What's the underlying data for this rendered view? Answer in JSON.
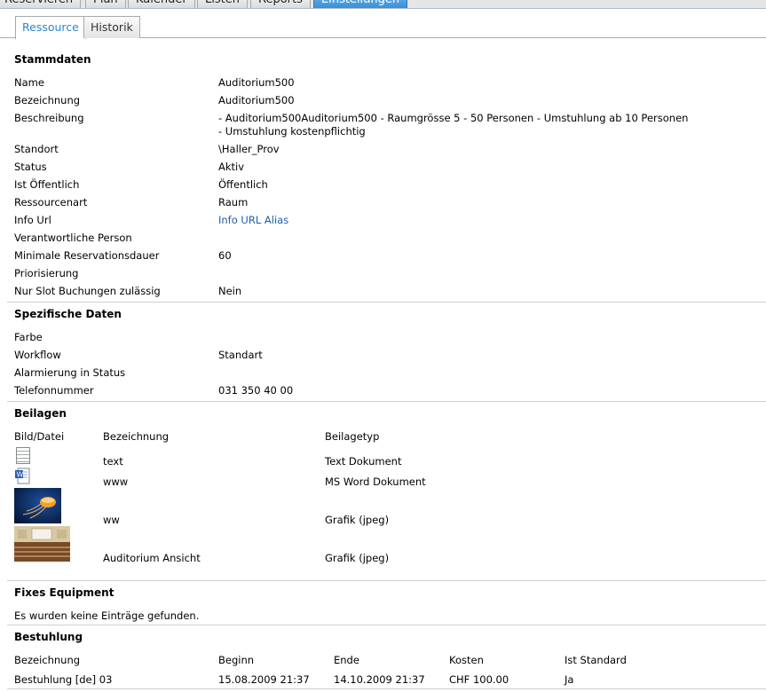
{
  "topnav": {
    "tabs": [
      "Reservieren",
      "Plan",
      "Kalender",
      "Listen",
      "Reports",
      "Einstellungen"
    ],
    "active": "Einstellungen"
  },
  "subtabs": [
    "Ressource",
    "Historik"
  ],
  "stammdaten": {
    "title": "Stammdaten",
    "rows": [
      {
        "label": "Name",
        "value": "Auditorium500"
      },
      {
        "label": "Bezeichnung",
        "value": "Auditorium500"
      },
      {
        "label": "Beschreibung",
        "value": "- Auditorium500Auditorium500 - Raumgrösse 5 - 50 Personen - Umstuhlung ab 10 Personen",
        "value2": "- Umstuhlung kostenpflichtig"
      },
      {
        "label": "Standort",
        "value": "\\Haller_Prov"
      },
      {
        "label": "Status",
        "value": "Aktiv"
      },
      {
        "label": "Ist Öffentlich",
        "value": "Öffentlich"
      },
      {
        "label": "Ressourcenart",
        "value": "Raum"
      },
      {
        "label": "Info Url",
        "value": "Info URL Alias"
      },
      {
        "label": "Verantwortliche Person",
        "value": ""
      },
      {
        "label": "Minimale Reservationsdauer",
        "value": "60"
      },
      {
        "label": "Priorisierung",
        "value": ""
      },
      {
        "label": "Nur Slot Buchungen zulässig",
        "value": "Nein"
      }
    ]
  },
  "spezifische": {
    "title": "Spezifische Daten",
    "rows": [
      {
        "label": "Farbe",
        "value": ""
      },
      {
        "label": "Workflow",
        "value": "Standart"
      },
      {
        "label": "Alarmierung in Status",
        "value": ""
      },
      {
        "label": "Telefonnummer",
        "value": "031 350 40 00"
      }
    ]
  },
  "beilagen": {
    "title": "Beilagen",
    "headers": [
      "Bild/Datei",
      "Bezeichnung",
      "Beilagetyp"
    ],
    "items": [
      {
        "icon": "text-document-icon",
        "name": "text",
        "type": "Text Dokument"
      },
      {
        "icon": "word-document-icon",
        "name": "www",
        "type": "MS Word Dokument"
      },
      {
        "icon": "jellyfish-thumbnail",
        "name": "ww",
        "type": "Grafik (jpeg)"
      },
      {
        "icon": "auditorium-thumbnail",
        "name": "Auditorium Ansicht",
        "type": "Grafik (jpeg)"
      }
    ]
  },
  "fixes": {
    "title": "Fixes Equipment",
    "empty": "Es wurden keine Einträge gefunden."
  },
  "bestuhlung": {
    "title": "Bestuhlung",
    "headers": [
      "Bezeichnung",
      "Beginn",
      "Ende",
      "Kosten",
      "Ist Standard"
    ],
    "rows": [
      [
        "Bestuhlung [de] 03",
        "15.08.2009 21:37",
        "14.10.2009 21:37",
        "CHF 100.00",
        "Ja"
      ]
    ]
  },
  "colors": {
    "accent": "#3a8fd6",
    "link": "#1f5fa8",
    "divider": "#cfcfcf"
  }
}
